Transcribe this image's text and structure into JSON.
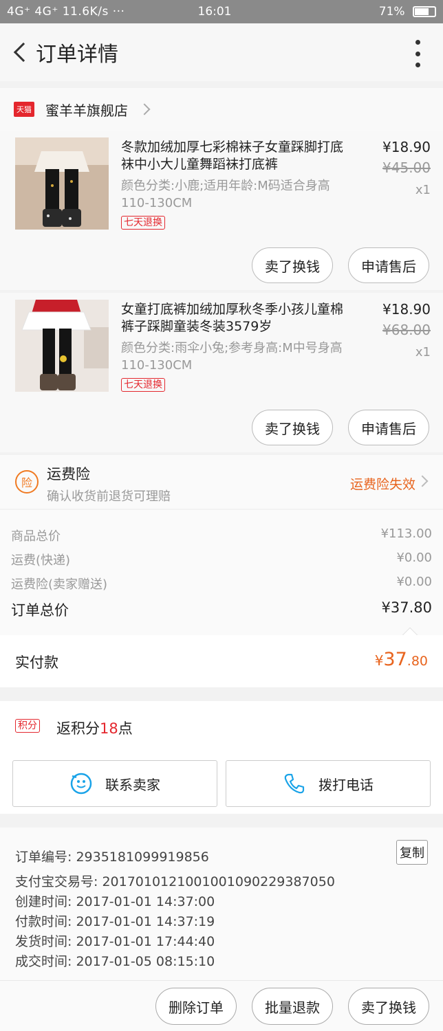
{
  "status_bar": {
    "left": "4G⁺ 4G⁺ 11.6K/s ···",
    "time": "16:01",
    "battery": "71%",
    "battery_level": 0.71
  },
  "nav": {
    "title": "订单详情"
  },
  "shop": {
    "badge": "天猫",
    "name": "蜜羊羊旗舰店"
  },
  "items": [
    {
      "title": "冬款加绒加厚七彩棉袜子女童踩脚打底袜中小大儿童舞蹈袜打底裤",
      "spec": "颜色分类:小鹿;适用年龄:M码适合身高110-130CM",
      "badge": "七天退换",
      "price": "¥18.90",
      "original_price": "¥45.00",
      "qty": "x1",
      "btn_sell": "卖了换钱",
      "btn_after": "申请售后"
    },
    {
      "title": "女童打底裤加绒加厚秋冬季小孩儿童棉裤子踩脚童装冬装3579岁",
      "spec": "颜色分类:雨伞小兔;参考身高:M中号身高110-130CM",
      "badge": "七天退换",
      "price": "¥18.90",
      "original_price": "¥68.00",
      "qty": "x1",
      "btn_sell": "卖了换钱",
      "btn_after": "申请售后"
    }
  ],
  "insurance": {
    "icon_text": "险",
    "title": "运费险",
    "subtitle": "确认收货前退货可理赔",
    "status": "运费险失效"
  },
  "summary": {
    "goods_label": "商品总价",
    "goods_value": "¥113.00",
    "shipping_label": "运费(快递)",
    "shipping_value": "¥0.00",
    "ins_label": "运费险(卖家赠送)",
    "ins_value": "¥0.00",
    "total_label": "订单总价",
    "total_value": "¥37.80"
  },
  "paid": {
    "label": "实付款",
    "symbol": "¥",
    "integer": "37",
    "decimal": ".80"
  },
  "points": {
    "tag": "积分",
    "prefix": "返积分",
    "value": "18",
    "suffix": "点"
  },
  "contact": {
    "seller": "联系卖家",
    "phone": "拨打电话"
  },
  "order_info": {
    "copy": "复制",
    "rows": [
      "订单编号: 2935181099919856",
      "支付宝交易号: 2017010121001001090229387050",
      "创建时间: 2017-01-01 14:37:00",
      "付款时间: 2017-01-01 14:37:19",
      "发货时间: 2017-01-01 17:44:40",
      "成交时间: 2017-01-05 08:15:10"
    ]
  },
  "bottom": {
    "delete": "删除订单",
    "refund": "批量退款",
    "sell": "卖了换钱"
  },
  "colors": {
    "accent": "#e8641e",
    "tmall_red": "#e4272e",
    "link_blue": "#1aa3e8"
  }
}
